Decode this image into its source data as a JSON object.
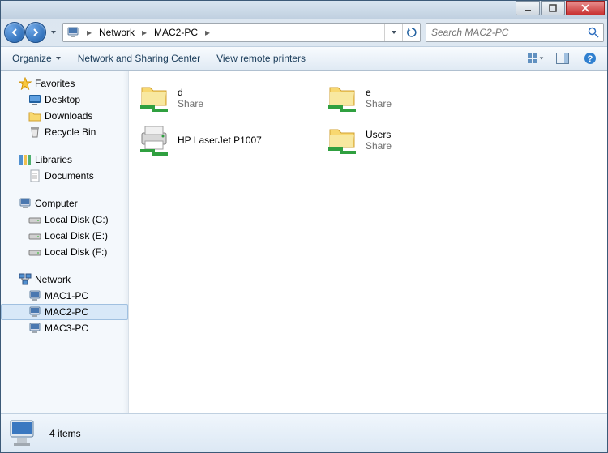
{
  "breadcrumb": {
    "root": "Network",
    "node": "MAC2-PC"
  },
  "search": {
    "placeholder": "Search MAC2-PC"
  },
  "toolbar": {
    "organize": "Organize",
    "network_center": "Network and Sharing Center",
    "view_printers": "View remote printers"
  },
  "sidebar": {
    "favorites": {
      "label": "Favorites",
      "items": [
        "Desktop",
        "Downloads",
        "Recycle Bin"
      ]
    },
    "libraries": {
      "label": "Libraries",
      "items": [
        "Documents"
      ]
    },
    "computer": {
      "label": "Computer",
      "items": [
        "Local Disk (C:)",
        "Local Disk (E:)",
        "Local Disk (F:)"
      ]
    },
    "network": {
      "label": "Network",
      "items": [
        "MAC1-PC",
        "MAC2-PC",
        "MAC3-PC"
      ]
    }
  },
  "items": [
    {
      "name": "d",
      "sub": "Share",
      "kind": "share"
    },
    {
      "name": "e",
      "sub": "Share",
      "kind": "share"
    },
    {
      "name": "HP LaserJet P1007",
      "sub": "",
      "kind": "printer"
    },
    {
      "name": "Users",
      "sub": "Share",
      "kind": "share"
    }
  ],
  "status": {
    "count_label": "4 items"
  },
  "selected_network_node": "MAC2-PC"
}
